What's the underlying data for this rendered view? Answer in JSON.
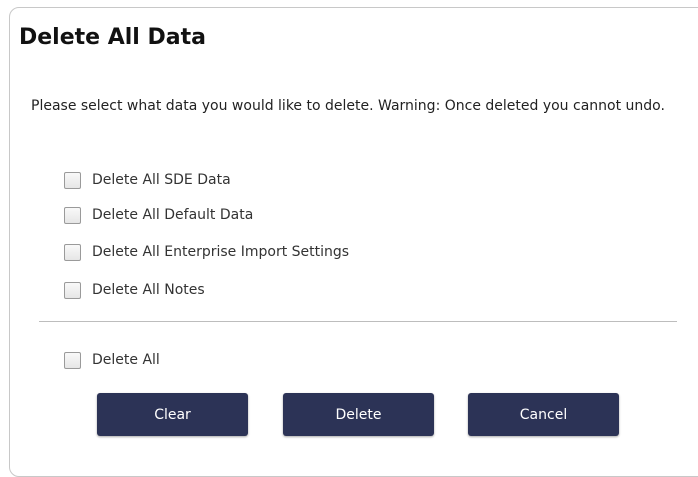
{
  "dialog": {
    "title": "Delete All Data",
    "description": "Please select what data you would like to delete. Warning: Once deleted you cannot undo."
  },
  "options": [
    {
      "label": "Delete All SDE Data",
      "checked": false
    },
    {
      "label": "Delete All Default Data",
      "checked": false
    },
    {
      "label": "Delete All Enterprise Import Settings",
      "checked": false
    },
    {
      "label": "Delete All Notes",
      "checked": false
    }
  ],
  "delete_all": {
    "label": "Delete All",
    "checked": false
  },
  "buttons": {
    "clear": "Clear",
    "delete": "Delete",
    "cancel": "Cancel"
  },
  "colors": {
    "button_bg": "#2c3356",
    "button_text": "#ffffff",
    "border": "#c8c8c8"
  }
}
